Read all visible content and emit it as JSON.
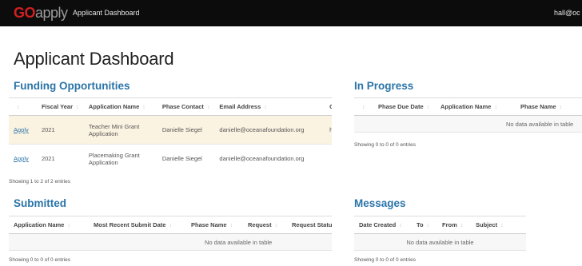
{
  "header": {
    "logo_go": "GO",
    "logo_apply": "apply",
    "app_title": "Applicant Dashboard",
    "user": "hall@oc"
  },
  "page": {
    "title": "Applicant Dashboard"
  },
  "funding": {
    "title": "Funding Opportunities",
    "columns": [
      "Fiscal Year",
      "Application Name",
      "Phase Contact",
      "Email Address",
      "C"
    ],
    "rows": [
      {
        "action": "Apply",
        "year": "2021",
        "name": "Teacher Mini Grant Application",
        "contact": "Danielle Siegel",
        "email": "danielle@oceanafoundation.org",
        "extra": "h n"
      },
      {
        "action": "Apply",
        "year": "2021",
        "name": "Placemaking Grant Application",
        "contact": "Danielle Siegel",
        "email": "danielle@oceanafoundation.org",
        "extra": ""
      }
    ],
    "info": "Showing 1 to 2 of 2 entries"
  },
  "in_progress": {
    "title": "In Progress",
    "columns": [
      "Phase Due Date",
      "Application Name",
      "Phase Name"
    ],
    "empty": "No data available in table",
    "info": "Showing 0 to 0 of 0 entries"
  },
  "submitted": {
    "title": "Submitted",
    "columns": [
      "Application Name",
      "Most Recent Submit Date",
      "Phase Name",
      "Request",
      "Request Statu"
    ],
    "empty": "No data available in table",
    "info": "Showing 0 to 0 of 0 entries"
  },
  "messages": {
    "title": "Messages",
    "columns": [
      "Date Created",
      "To",
      "From",
      "Subject"
    ],
    "empty": "No data available in table",
    "info": "Showing 0 to 0 of 0 entries"
  },
  "sort_glyph": "↕",
  "colors": {
    "topbar": "#0c0c0c",
    "logo_go": "#d21f1f",
    "section_title": "#2a74a8",
    "row_highlight": "#fbf3e2"
  }
}
